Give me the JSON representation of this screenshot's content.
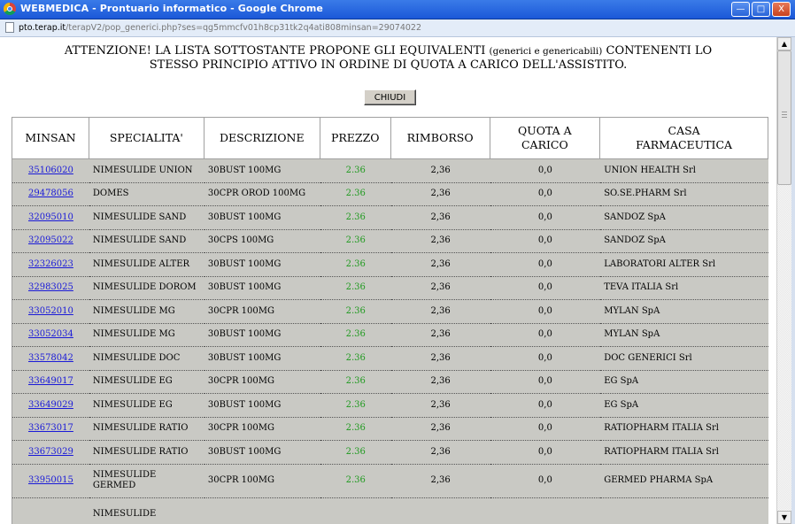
{
  "window": {
    "title": "WEBMEDICA - Prontuario informatico - Google Chrome",
    "minimize_label": "—",
    "maximize_label": "□",
    "close_label": "X"
  },
  "address": {
    "host": "pto.terap.it",
    "path": "/terapV2/pop_generici.php?ses=qg5mmcfv01h8cp31tk2q4ati808minsan=29074022"
  },
  "notice": {
    "line1_start": "ATTENZIONE! LA LISTA SOTTOSTANTE PROPONE GLI EQUIVALENTI",
    "line1_small": "(generici e genericabili)",
    "line1_end": "CONTENENTI LO",
    "line2": "STESSO PRINCIPIO ATTIVO IN ORDINE DI QUOTA A CARICO DELL'ASSISTITO."
  },
  "close_button_label": "CHIUDI",
  "table": {
    "headers": {
      "minsan": "MINSAN",
      "specialita": "SPECIALITA'",
      "descrizione": "DESCRIZIONE",
      "prezzo": "PREZZO",
      "rimborso": "RIMBORSO",
      "quota_line1": "QUOTA A",
      "quota_line2": "CARICO",
      "casa_line1": "CASA",
      "casa_line2": "FARMACEUTICA"
    },
    "rows": [
      {
        "minsan": "35106020",
        "specialita": "NIMESULIDE UNION",
        "descrizione": "30BUST 100MG",
        "prezzo": "2.36",
        "rimborso": "2,36",
        "quota": "0,0",
        "casa": "UNION HEALTH Srl"
      },
      {
        "minsan": "29478056",
        "specialita": "DOMES",
        "descrizione": "30CPR OROD 100MG",
        "prezzo": "2.36",
        "rimborso": "2,36",
        "quota": "0,0",
        "casa": "SO.SE.PHARM Srl"
      },
      {
        "minsan": "32095010",
        "specialita": "NIMESULIDE SAND",
        "descrizione": "30BUST 100MG",
        "prezzo": "2.36",
        "rimborso": "2,36",
        "quota": "0,0",
        "casa": "SANDOZ SpA"
      },
      {
        "minsan": "32095022",
        "specialita": "NIMESULIDE SAND",
        "descrizione": "30CPS 100MG",
        "prezzo": "2.36",
        "rimborso": "2,36",
        "quota": "0,0",
        "casa": "SANDOZ SpA"
      },
      {
        "minsan": "32326023",
        "specialita": "NIMESULIDE ALTER",
        "descrizione": "30BUST 100MG",
        "prezzo": "2.36",
        "rimborso": "2,36",
        "quota": "0,0",
        "casa": "LABORATORI ALTER Srl"
      },
      {
        "minsan": "32983025",
        "specialita": "NIMESULIDE DOROM",
        "descrizione": "30BUST 100MG",
        "prezzo": "2.36",
        "rimborso": "2,36",
        "quota": "0,0",
        "casa": "TEVA ITALIA Srl"
      },
      {
        "minsan": "33052010",
        "specialita": "NIMESULIDE MG",
        "descrizione": "30CPR 100MG",
        "prezzo": "2.36",
        "rimborso": "2,36",
        "quota": "0,0",
        "casa": "MYLAN SpA"
      },
      {
        "minsan": "33052034",
        "specialita": "NIMESULIDE MG",
        "descrizione": "30BUST 100MG",
        "prezzo": "2.36",
        "rimborso": "2,36",
        "quota": "0,0",
        "casa": "MYLAN SpA"
      },
      {
        "minsan": "33578042",
        "specialita": "NIMESULIDE DOC",
        "descrizione": "30BUST 100MG",
        "prezzo": "2.36",
        "rimborso": "2,36",
        "quota": "0,0",
        "casa": "DOC GENERICI Srl"
      },
      {
        "minsan": "33649017",
        "specialita": "NIMESULIDE EG",
        "descrizione": "30CPR 100MG",
        "prezzo": "2.36",
        "rimborso": "2,36",
        "quota": "0,0",
        "casa": "EG SpA"
      },
      {
        "minsan": "33649029",
        "specialita": "NIMESULIDE EG",
        "descrizione": "30BUST 100MG",
        "prezzo": "2.36",
        "rimborso": "2,36",
        "quota": "0,0",
        "casa": "EG SpA"
      },
      {
        "minsan": "33673017",
        "specialita": "NIMESULIDE RATIO",
        "descrizione": "30CPR 100MG",
        "prezzo": "2.36",
        "rimborso": "2,36",
        "quota": "0,0",
        "casa": "RATIOPHARM ITALIA Srl"
      },
      {
        "minsan": "33673029",
        "specialita": "NIMESULIDE RATIO",
        "descrizione": "30BUST 100MG",
        "prezzo": "2.36",
        "rimborso": "2,36",
        "quota": "0,0",
        "casa": "RATIOPHARM ITALIA Srl"
      },
      {
        "minsan": "33950015",
        "specialita": "NIMESULIDE GERMED",
        "descrizione": "30CPR 100MG",
        "prezzo": "2.36",
        "rimborso": "2,36",
        "quota": "0,0",
        "casa": "GERMED PHARMA SpA"
      },
      {
        "minsan": "",
        "specialita": "NIMESULIDE",
        "descrizione": "",
        "prezzo": "",
        "rimborso": "",
        "quota": "",
        "casa": ""
      }
    ]
  },
  "colors": {
    "titlebar": "#1b58d8",
    "row_background": "#c9c9c4",
    "link": "#1a1ad8",
    "price": "#1f9a1f"
  },
  "icons": {
    "browser": "chrome-icon",
    "page": "page-icon"
  }
}
